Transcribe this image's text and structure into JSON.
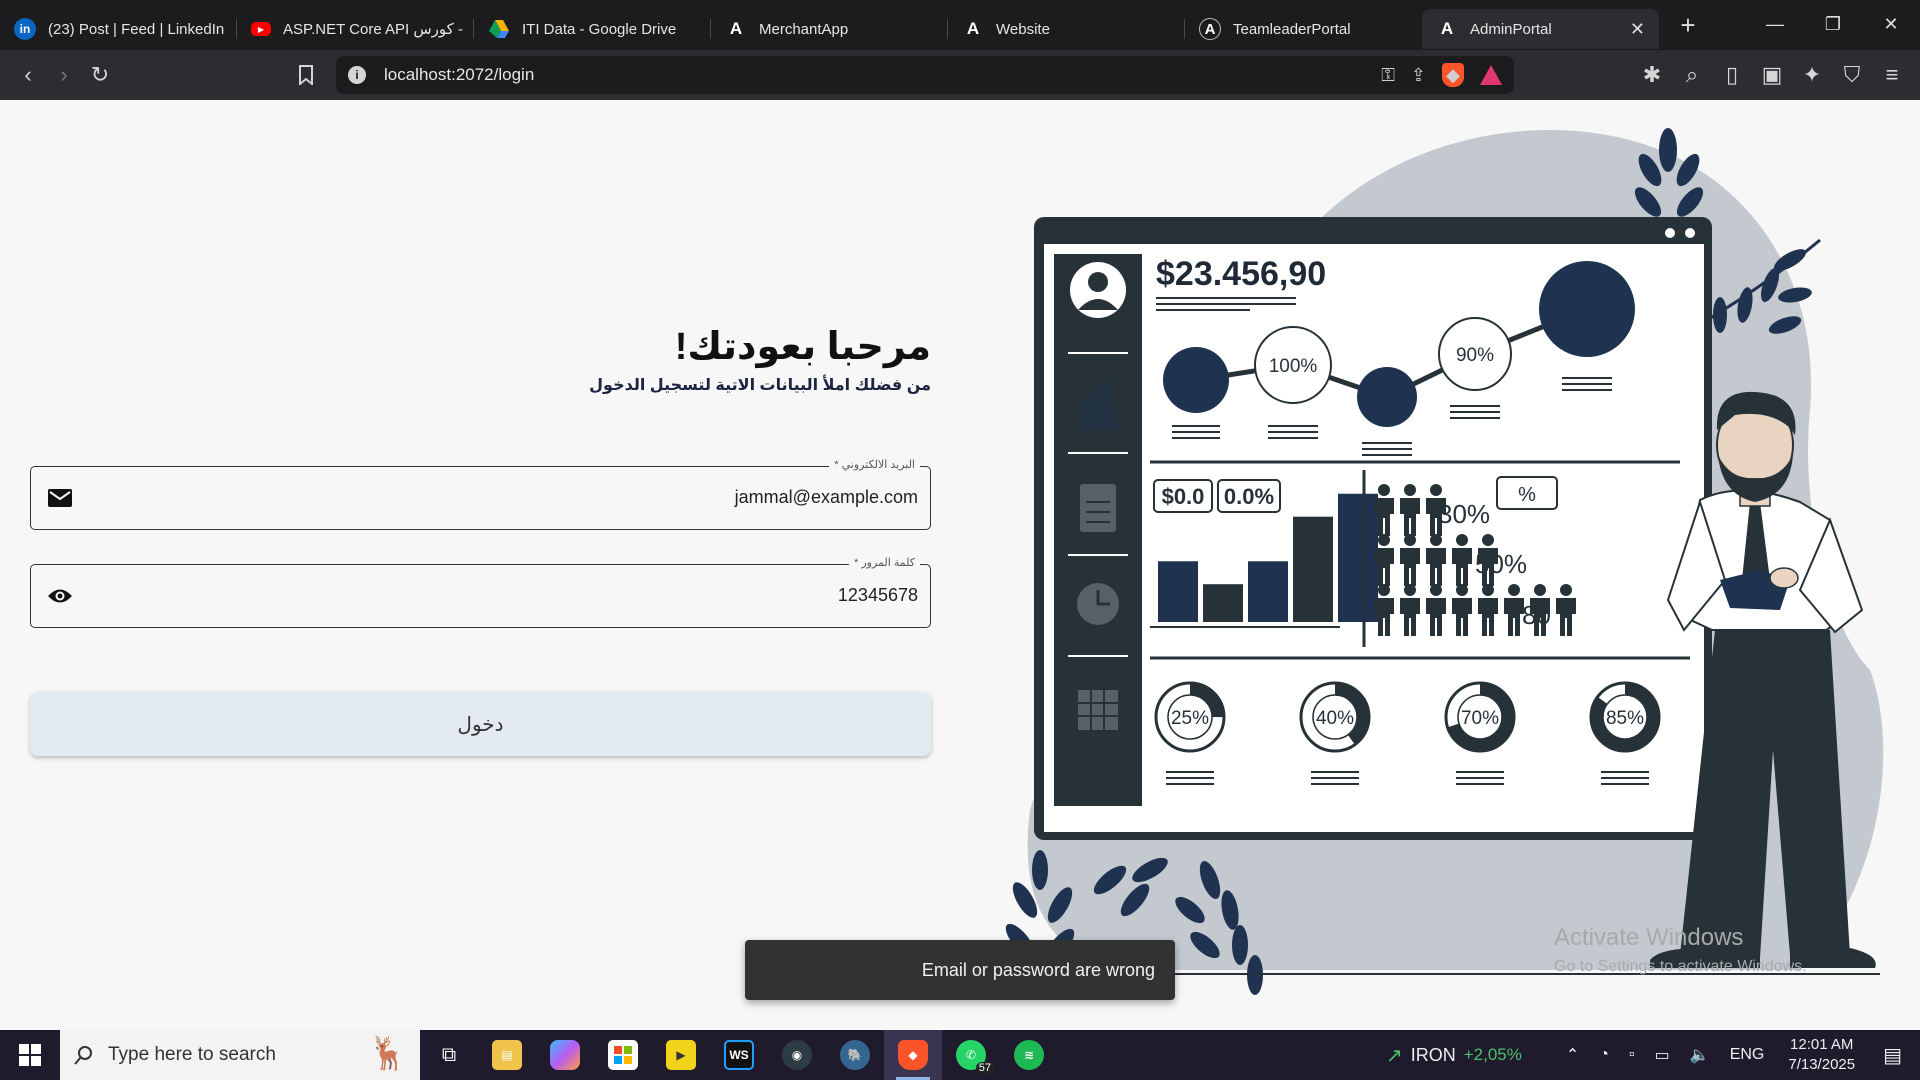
{
  "browser": {
    "tabs": [
      {
        "title": "(23) Post | Feed | LinkedIn",
        "icon": "linkedin-icon",
        "color": "#0a66c2"
      },
      {
        "title": "ASP.NET Core API كورس -",
        "icon": "youtube-icon",
        "color": "#ff0000"
      },
      {
        "title": "ITI Data - Google Drive",
        "icon": "google-drive-icon",
        "color": "#f4b400"
      },
      {
        "title": "MerchantApp",
        "icon": "angular-icon",
        "color": "#ffffff"
      },
      {
        "title": "Website",
        "icon": "angular-icon",
        "color": "#ffffff"
      },
      {
        "title": "TeamleaderPortal",
        "icon": "angular-icon",
        "color": "#ffffff"
      },
      {
        "title": "AdminPortal",
        "icon": "angular-icon",
        "color": "#ffffff",
        "active": true
      }
    ],
    "url": "localhost:2072/login"
  },
  "login": {
    "title": "مرحبا بعودتك!",
    "subtitle": "من فضلك املأ البيانات الاتية لتسجيل الدخول",
    "email_label": "البريد الالكتروني *",
    "email_value": "jammal@example.com",
    "password_label": "كلمة المرور *",
    "password_value": "12345678",
    "submit_label": "دخول"
  },
  "illustration": {
    "amount": "$23.456,90",
    "timeline_labels": [
      "100%",
      "90%"
    ],
    "stat_boxes": [
      "$0.0",
      "0.0%",
      "%"
    ],
    "people_stats": [
      "30%",
      "50%",
      "80"
    ],
    "donuts": [
      {
        "label": "25%",
        "value": 25
      },
      {
        "label": "40%",
        "value": 40
      },
      {
        "label": "70%",
        "value": 70
      },
      {
        "label": "85%",
        "value": 85
      }
    ],
    "bars": [
      0.45,
      0.28,
      0.45,
      0.78,
      0.95
    ],
    "accent_color": "#1f3350",
    "dark_color": "#263238",
    "blob_color": "#c4c9d0"
  },
  "toast": {
    "message": "Email or password are wrong"
  },
  "watermark": {
    "line1": "Activate Windows",
    "line2": "Go to Settings to activate Windows."
  },
  "taskbar": {
    "search_placeholder": "Type here to search",
    "whatsapp_badge": "57",
    "stock_name": "IRON",
    "stock_change": "+2,05%",
    "language": "ENG",
    "time": "12:01 AM",
    "date": "7/13/2025"
  }
}
